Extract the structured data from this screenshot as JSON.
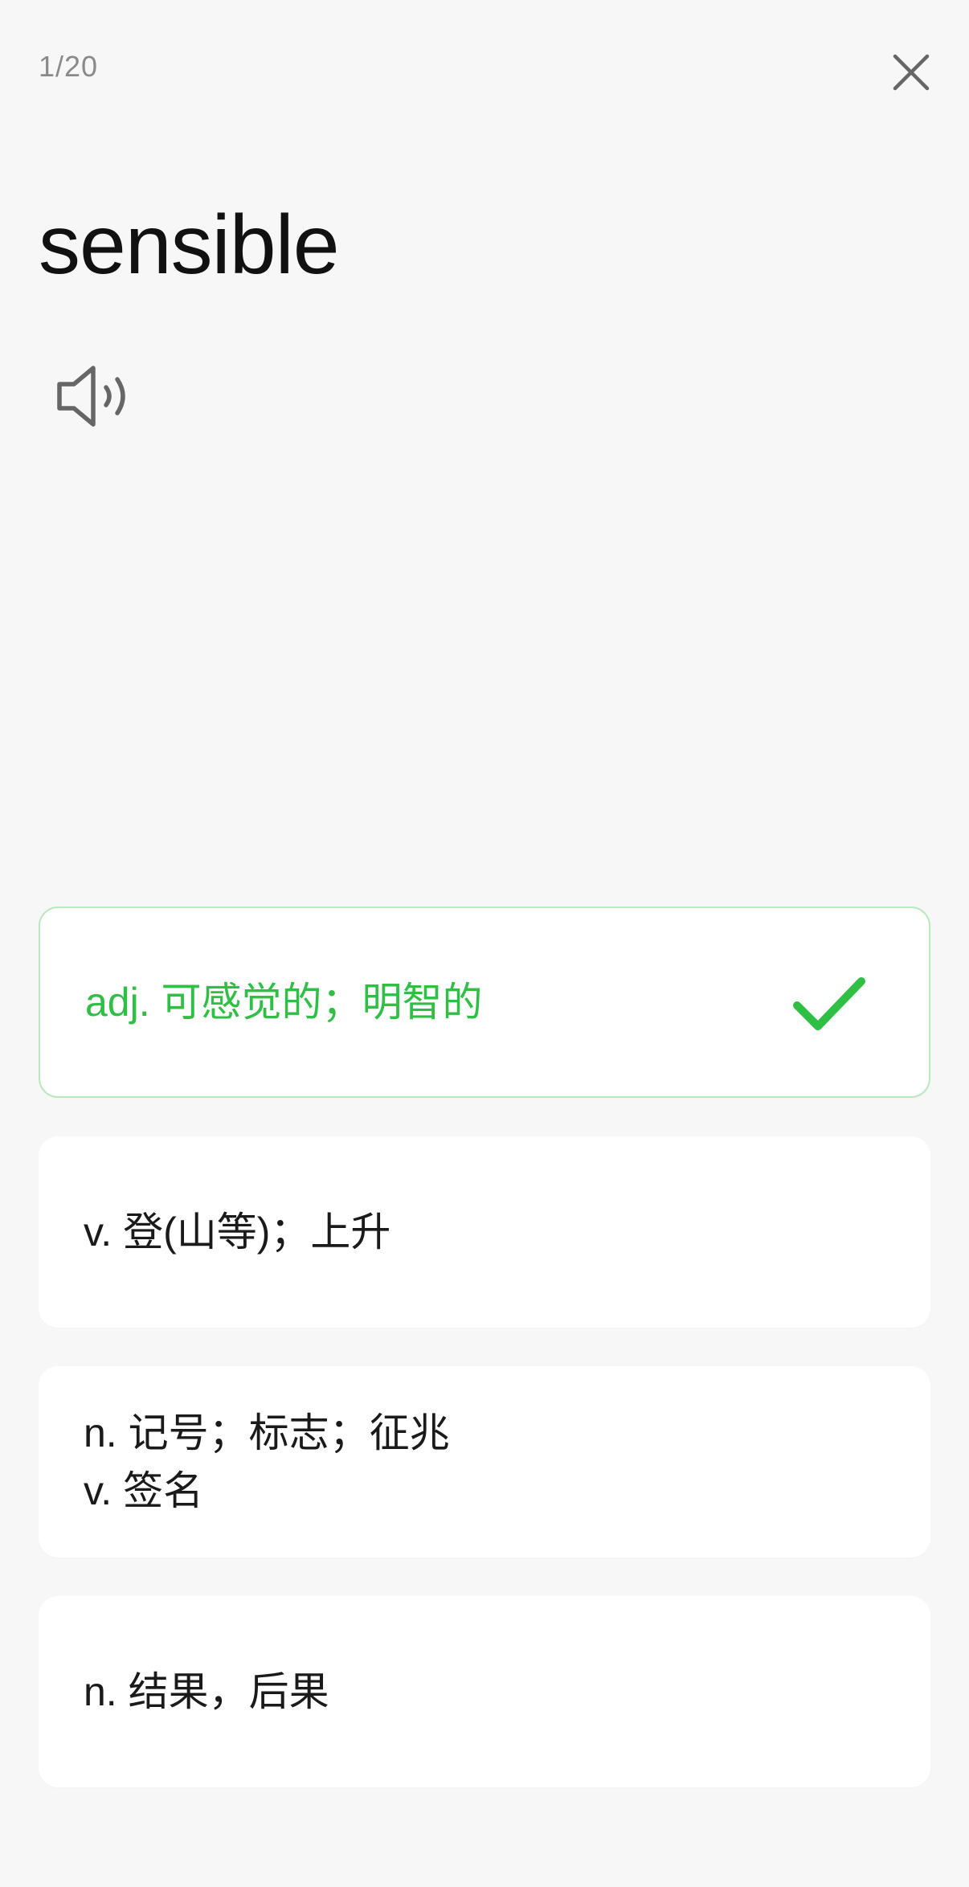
{
  "header": {
    "progress": "1/20",
    "close_icon": "close-icon"
  },
  "word": {
    "text": "sensible",
    "audio_icon": "speaker-icon"
  },
  "colors": {
    "correct": "#2fbf45",
    "correct_border": "#b9e8bf",
    "background": "#f7f7f7"
  },
  "options": [
    {
      "lines": [
        "adj. 可感觉的；明智的"
      ],
      "state": "correct",
      "icon": "check-icon"
    },
    {
      "lines": [
        "v. 登(山等)；上升"
      ],
      "state": "default"
    },
    {
      "lines": [
        "n. 记号；标志；征兆",
        "v. 签名"
      ],
      "state": "default"
    },
    {
      "lines": [
        "n. 结果，后果"
      ],
      "state": "default"
    }
  ]
}
